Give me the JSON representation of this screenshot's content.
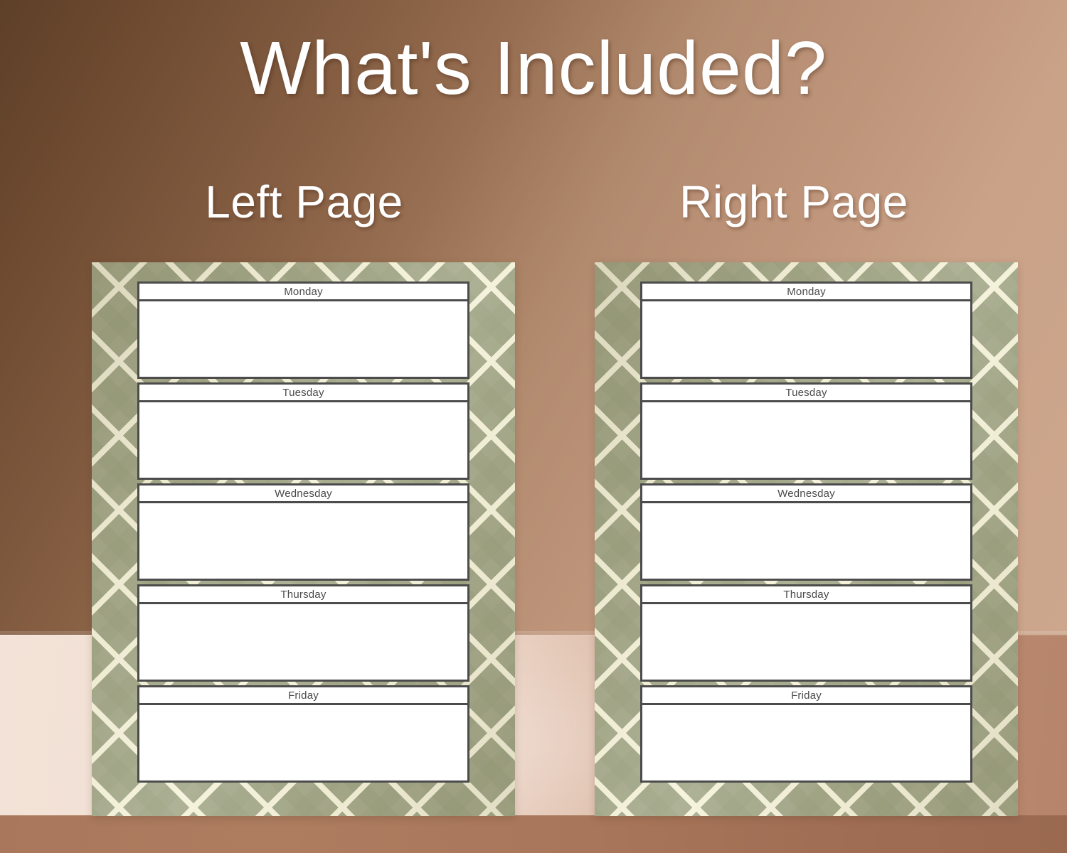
{
  "header": {
    "title": "What's Included?"
  },
  "pages": [
    {
      "caption": "Left Page",
      "side": "left",
      "days": [
        "Monday",
        "Tuesday",
        "Wednesday",
        "Thursday",
        "Friday"
      ]
    },
    {
      "caption": "Right Page",
      "side": "right",
      "days": [
        "Monday",
        "Tuesday",
        "Wednesday",
        "Thursday",
        "Friday"
      ]
    }
  ],
  "colors": {
    "background_top_left": "#6E4B31",
    "background_top_right": "#C9A288",
    "floor": "#F2E0D5",
    "floor_strip": "#A8765A",
    "page_pattern_base": "#A8AC8E",
    "page_pattern_line": "#F5F2DA",
    "box_border": "#4C4C4C",
    "box_fill": "#FFFFFF",
    "day_text": "#4A4A4A",
    "heading_text": "#FFFFFF"
  }
}
